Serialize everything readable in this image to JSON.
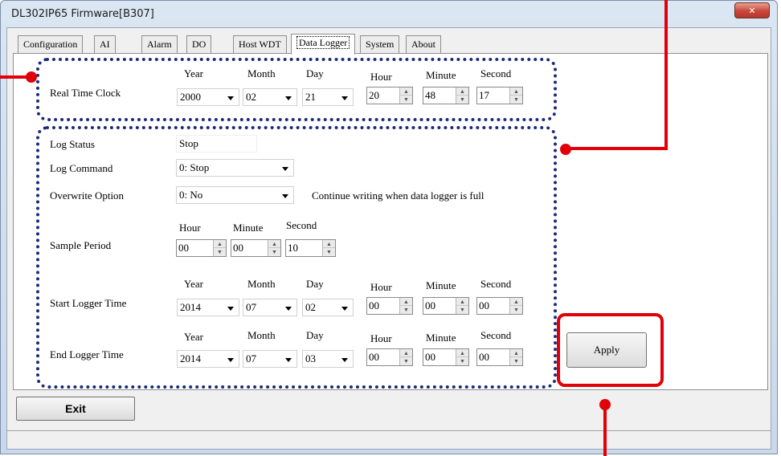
{
  "window": {
    "title": "DL302IP65 Firmware[B307]",
    "close_symbol": "✕"
  },
  "tabs": [
    {
      "label": "Configuration"
    },
    {
      "label": "AI"
    },
    {
      "label": "Alarm"
    },
    {
      "label": "DO"
    },
    {
      "label": "Host WDT"
    },
    {
      "label": "Data Logger",
      "active": true
    },
    {
      "label": "System"
    },
    {
      "label": "About"
    }
  ],
  "rtc": {
    "label": "Real Time Clock",
    "headers": {
      "year": "Year",
      "month": "Month",
      "day": "Day",
      "hour": "Hour",
      "minute": "Minute",
      "second": "Second"
    },
    "year": "2000",
    "month": "02",
    "day": "21",
    "hour": "20",
    "minute": "48",
    "second": "17"
  },
  "log": {
    "status_label": "Log Status",
    "status_value": "Stop",
    "command_label": "Log Command",
    "command_value": "0: Stop",
    "overwrite_label": "Overwrite Option",
    "overwrite_value": "0: No",
    "overwrite_note": "Continue writing when data logger is full",
    "sample_label": "Sample Period",
    "sample_headers": {
      "hour": "Hour",
      "minute": "Minute",
      "second": "Second"
    },
    "sample_hour": "00",
    "sample_minute": "00",
    "sample_second": "10"
  },
  "start_time": {
    "label": "Start Logger Time",
    "headers": {
      "year": "Year",
      "month": "Month",
      "day": "Day",
      "hour": "Hour",
      "minute": "Minute",
      "second": "Second"
    },
    "year": "2014",
    "month": "07",
    "day": "02",
    "hour": "00",
    "minute": "00",
    "second": "00"
  },
  "end_time": {
    "label": "End Logger Time",
    "headers": {
      "year": "Year",
      "month": "Month",
      "day": "Day",
      "hour": "Hour",
      "minute": "Minute",
      "second": "Second"
    },
    "year": "2014",
    "month": "07",
    "day": "03",
    "hour": "00",
    "minute": "00",
    "second": "00"
  },
  "buttons": {
    "apply": "Apply",
    "exit": "Exit"
  },
  "colors": {
    "annotation": "#e0000a",
    "dotted_border": "#1a2a7a"
  }
}
